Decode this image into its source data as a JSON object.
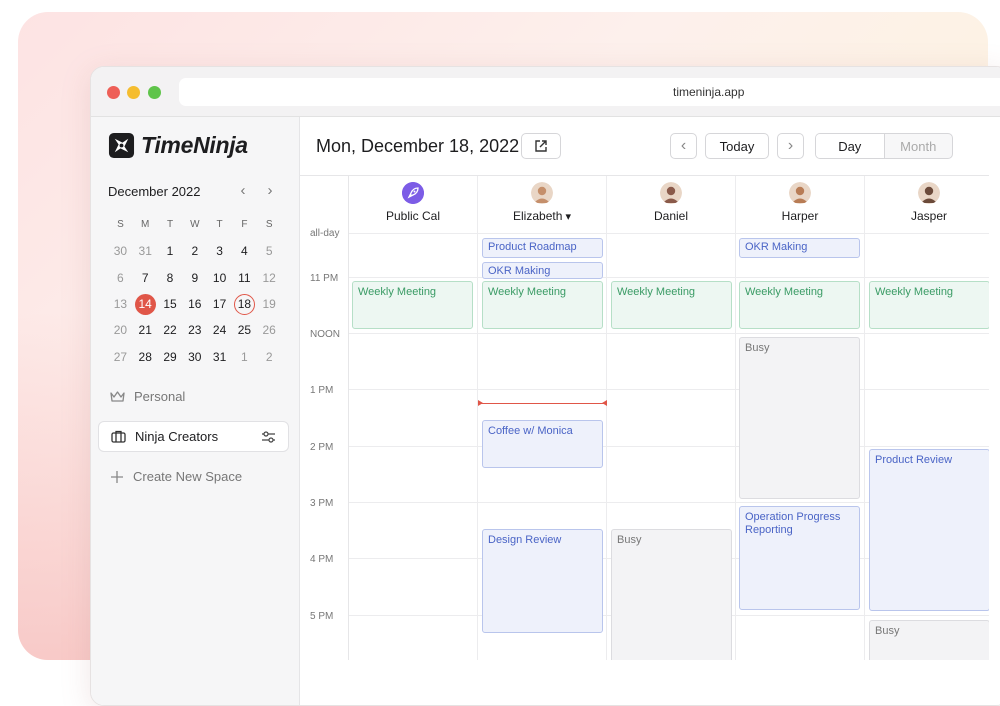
{
  "browser": {
    "url": "timeninja.app"
  },
  "brand": {
    "name": "TimeNinja"
  },
  "mini_calendar": {
    "month_label": "December 2022",
    "prev_icon": "chevron-left-icon",
    "next_icon": "chevron-right-icon",
    "dow": [
      "S",
      "M",
      "T",
      "W",
      "T",
      "F",
      "S"
    ],
    "weeks": [
      [
        "30",
        "31",
        "1",
        "2",
        "3",
        "4",
        "5"
      ],
      [
        "6",
        "7",
        "8",
        "9",
        "10",
        "11",
        "12"
      ],
      [
        "13",
        "14",
        "15",
        "16",
        "17",
        "18",
        "19"
      ],
      [
        "20",
        "21",
        "22",
        "23",
        "24",
        "25",
        "26"
      ],
      [
        "27",
        "28",
        "29",
        "30",
        "31",
        "1",
        "2"
      ]
    ],
    "today": "14",
    "selected": "18"
  },
  "spaces": [
    {
      "label": "Personal",
      "icon": "crown-icon"
    },
    {
      "label": "Ninja Creators",
      "icon": "briefcase-icon",
      "active": true
    },
    {
      "label": "Create New Space",
      "icon": "plus-icon"
    }
  ],
  "header": {
    "date": "Mon, December 18, 2022",
    "today_label": "Today",
    "views": [
      "Day",
      "Month"
    ],
    "active_view": "Day"
  },
  "time_labels": [
    "all-day",
    "11 PM",
    "NOON",
    "1 PM",
    "2 PM",
    "3 PM",
    "4 PM",
    "5 PM"
  ],
  "columns": [
    {
      "name": "Public Cal",
      "avatar_color": "#7c5ce6"
    },
    {
      "name": "Elizabeth",
      "avatar_color": "#c58f6b",
      "has_dropdown": true
    },
    {
      "name": "Daniel",
      "avatar_color": "#8a5a4a"
    },
    {
      "name": "Harper",
      "avatar_color": "#b87c55"
    },
    {
      "name": "Jasper",
      "avatar_color": "#6b4a3a"
    }
  ],
  "events": [
    {
      "column": 1,
      "title": "Product Roadmap",
      "style": "blue"
    },
    {
      "column": 1,
      "title": "OKR Making",
      "style": "blue"
    },
    {
      "column": 3,
      "title": "OKR Making",
      "style": "blue"
    },
    {
      "column": 0,
      "title": "Weekly Meeting",
      "style": "green"
    },
    {
      "column": 1,
      "title": "Weekly Meeting",
      "style": "green"
    },
    {
      "column": 2,
      "title": "Weekly Meeting",
      "style": "green"
    },
    {
      "column": 3,
      "title": "Weekly Meeting",
      "style": "green"
    },
    {
      "column": 4,
      "title": "Weekly Meeting",
      "style": "green"
    },
    {
      "column": 3,
      "title": "Busy",
      "style": "busy"
    },
    {
      "column": 1,
      "title": "Coffee w/ Monica",
      "style": "blue"
    },
    {
      "column": 4,
      "title": "Product Review",
      "style": "blue"
    },
    {
      "column": 3,
      "title": "Operation Progress Reporting",
      "style": "blue"
    },
    {
      "column": 1,
      "title": "Design Review",
      "style": "blue"
    },
    {
      "column": 2,
      "title": "Busy",
      "style": "busy"
    },
    {
      "column": 4,
      "title": "Busy",
      "style": "busy"
    }
  ]
}
